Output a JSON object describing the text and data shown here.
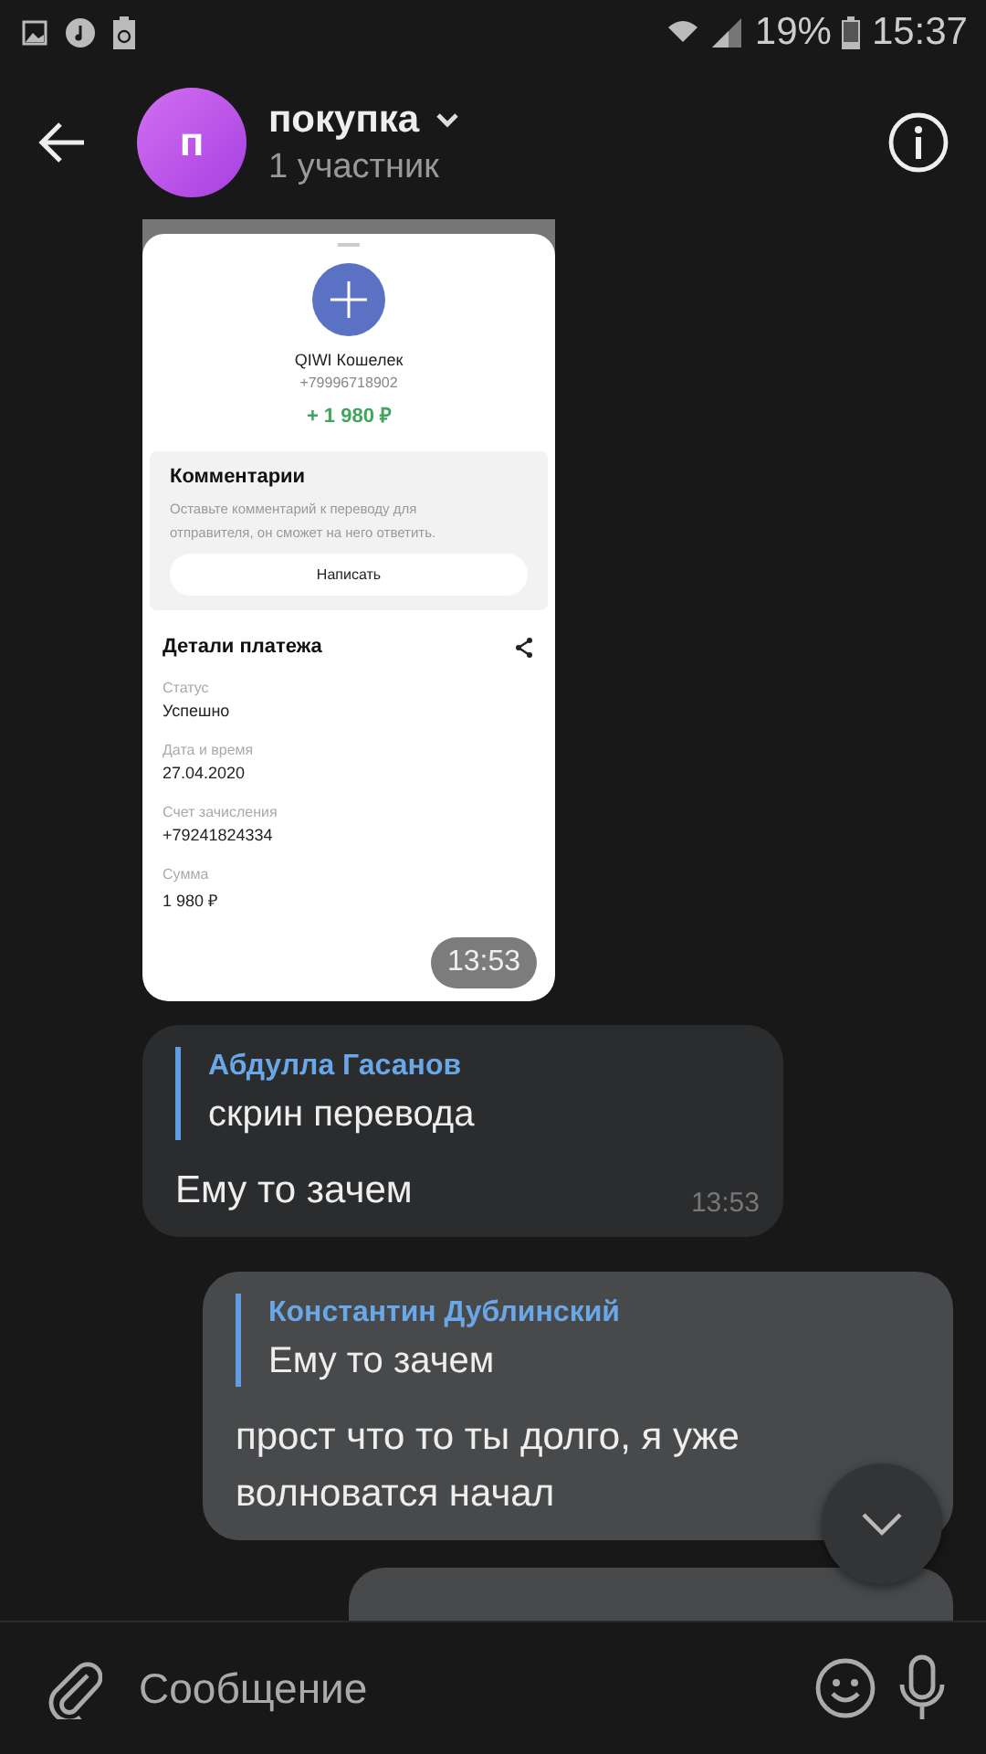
{
  "status_bar": {
    "battery": "19%",
    "time": "15:37"
  },
  "header": {
    "avatar_letter": "п",
    "title": "покупка",
    "subtitle": "1 участник"
  },
  "messages": [
    {
      "kind": "image",
      "time": "13:53",
      "screenshot": {
        "name": "QIWI Кошелек",
        "phone": "+79996718902",
        "amount": "+ 1 980 ₽",
        "comments_title": "Комментарии",
        "comments_hint": "Оставьте комментарий к переводу для отправителя, он сможет на него ответить.",
        "write_button": "Написать",
        "details_title": "Детали платежа",
        "fields": [
          {
            "label": "Статус",
            "value": "Успешно"
          },
          {
            "label": "Дата и время",
            "value": "27.04.2020"
          },
          {
            "label": "Счет зачисления",
            "value": "+79241824334"
          },
          {
            "label": "Сумма",
            "value": "1 980 ₽"
          }
        ]
      }
    },
    {
      "kind": "reply",
      "outgoing": false,
      "reply_author": "Абдулла Гасанов",
      "reply_text": "скрин перевода",
      "text": "Ему то зачем",
      "time": "13:53"
    },
    {
      "kind": "reply",
      "outgoing": true,
      "reply_author": "Константин Дублинский",
      "reply_text": "Ему то зачем",
      "text": "прост что то ты долго, я уже волноватся начал"
    },
    {
      "kind": "partial",
      "outgoing": true
    }
  ],
  "composer": {
    "placeholder": "Сообщение"
  }
}
